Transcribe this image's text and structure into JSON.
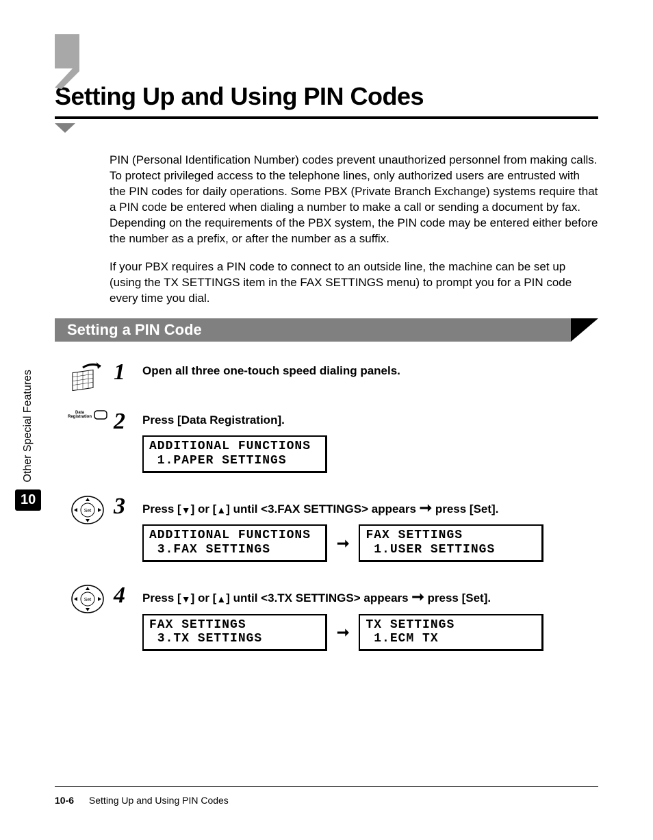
{
  "main_title": "Setting Up and Using PIN Codes",
  "para1": "PIN (Personal Identification Number) codes prevent unauthorized personnel from making calls. To protect privileged access to the telephone lines, only authorized users are entrusted with the PIN codes for daily operations. Some PBX (Private Branch Exchange) systems require that a PIN code be entered when dialing a number to make a call or sending a document by fax. Depending on the requirements of the PBX system, the PIN code may be entered either before the number as a prefix, or after the number as a suffix.",
  "para2": "If your PBX requires a PIN code to connect to an outside line, the machine can be set up (using the TX SETTINGS item in the FAX SETTINGS menu) to prompt you for a PIN code every time you dial.",
  "section_title": "Setting a PIN Code",
  "steps": {
    "s1": {
      "num": "1",
      "text": "Open all three one-touch speed dialing panels."
    },
    "s2": {
      "num": "2",
      "text": "Press [Data Registration].",
      "lcd1": "ADDITIONAL FUNCTIONS\n 1.PAPER SETTINGS",
      "icon_label_top": "Data",
      "icon_label_bot": "Registration"
    },
    "s3": {
      "num": "3",
      "text_pre": "Press [",
      "text_mid1": "] or [",
      "text_mid2": "] until <3.FAX SETTINGS> appears ",
      "text_post": " press [Set].",
      "lcd1": "ADDITIONAL FUNCTIONS\n 3.FAX SETTINGS",
      "lcd2": "FAX SETTINGS\n 1.USER SETTINGS"
    },
    "s4": {
      "num": "4",
      "text_pre": "Press [",
      "text_mid1": "] or [",
      "text_mid2": "] until <3.TX SETTINGS> appears ",
      "text_post": " press [Set].",
      "lcd1": "FAX SETTINGS\n 3.TX SETTINGS",
      "lcd2": "TX SETTINGS\n 1.ECM TX"
    }
  },
  "arrow": "➞",
  "tri_down": "▼",
  "tri_up": "▲",
  "sidebar": {
    "vertical": "Other Special Features",
    "chapter": "10"
  },
  "footer": {
    "page": "10-6",
    "title": "Setting Up and Using PIN Codes"
  }
}
